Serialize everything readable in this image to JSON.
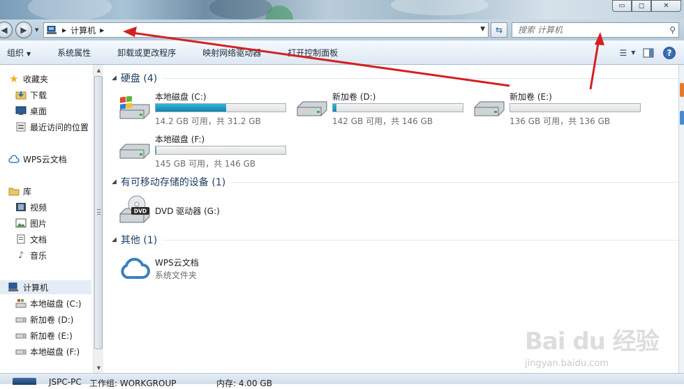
{
  "window": {
    "minimize_glyph": "▭",
    "maximize_glyph": "◻",
    "close_glyph": "✕"
  },
  "address_bar": {
    "location": "计算机",
    "back_glyph": "◀",
    "forward_glyph": "▶",
    "search_placeholder": "搜索 计算机"
  },
  "toolbar": {
    "items": [
      {
        "label": "组织",
        "dropdown": true
      },
      {
        "label": "系统属性"
      },
      {
        "label": "卸载或更改程序"
      },
      {
        "label": "映射网络驱动器"
      },
      {
        "label": "打开控制面板"
      }
    ],
    "help_glyph": "?"
  },
  "nav": {
    "favorites": {
      "label": "收藏夹",
      "items": [
        "下载",
        "桌面",
        "最近访问的位置"
      ]
    },
    "wps": "WPS云文档",
    "libraries": {
      "label": "库",
      "items": [
        "视频",
        "图片",
        "文档",
        "音乐"
      ]
    },
    "computer": {
      "label": "计算机",
      "items": [
        "本地磁盘 (C:)",
        "新加卷 (D:)",
        "新加卷 (E:)",
        "本地磁盘 (F:)"
      ]
    }
  },
  "content": {
    "hard_disks_header": "硬盘 (4)",
    "drives": [
      {
        "name": "本地磁盘 (C:)",
        "free": "14.2 GB 可用，共 31.2 GB",
        "used_fraction": 0.545,
        "icon": "windows-drive-icon"
      },
      {
        "name": "新加卷 (D:)",
        "free": "142 GB 可用，共 146 GB",
        "used_fraction": 0.027,
        "icon": "hard-drive-icon"
      },
      {
        "name": "新加卷 (E:)",
        "free": "136 GB 可用，共 136 GB",
        "used_fraction": 0.0,
        "icon": "hard-drive-icon"
      },
      {
        "name": "本地磁盘 (F:)",
        "free": "145 GB 可用，共 146 GB",
        "used_fraction": 0.007,
        "icon": "hard-drive-icon"
      }
    ],
    "removable_header": "有可移动存储的设备 (1)",
    "dvd": {
      "name": "DVD 驱动器 (G:)",
      "badge": "DVD"
    },
    "other_header": "其他 (1)",
    "wps_item": {
      "name": "WPS云文档",
      "type": "系统文件夹"
    }
  },
  "statusbar": {
    "pc_name": "JSPC-PC",
    "workgroup": "工作组: WORKGROUP",
    "memory": "内存: 4.00 GB"
  },
  "watermark": {
    "text": "Bai du 经验",
    "url": "jingyan.baidu.com"
  },
  "colors": {
    "annotation_arrow": "#d42020",
    "drive_fill": "#1e9bc6"
  }
}
